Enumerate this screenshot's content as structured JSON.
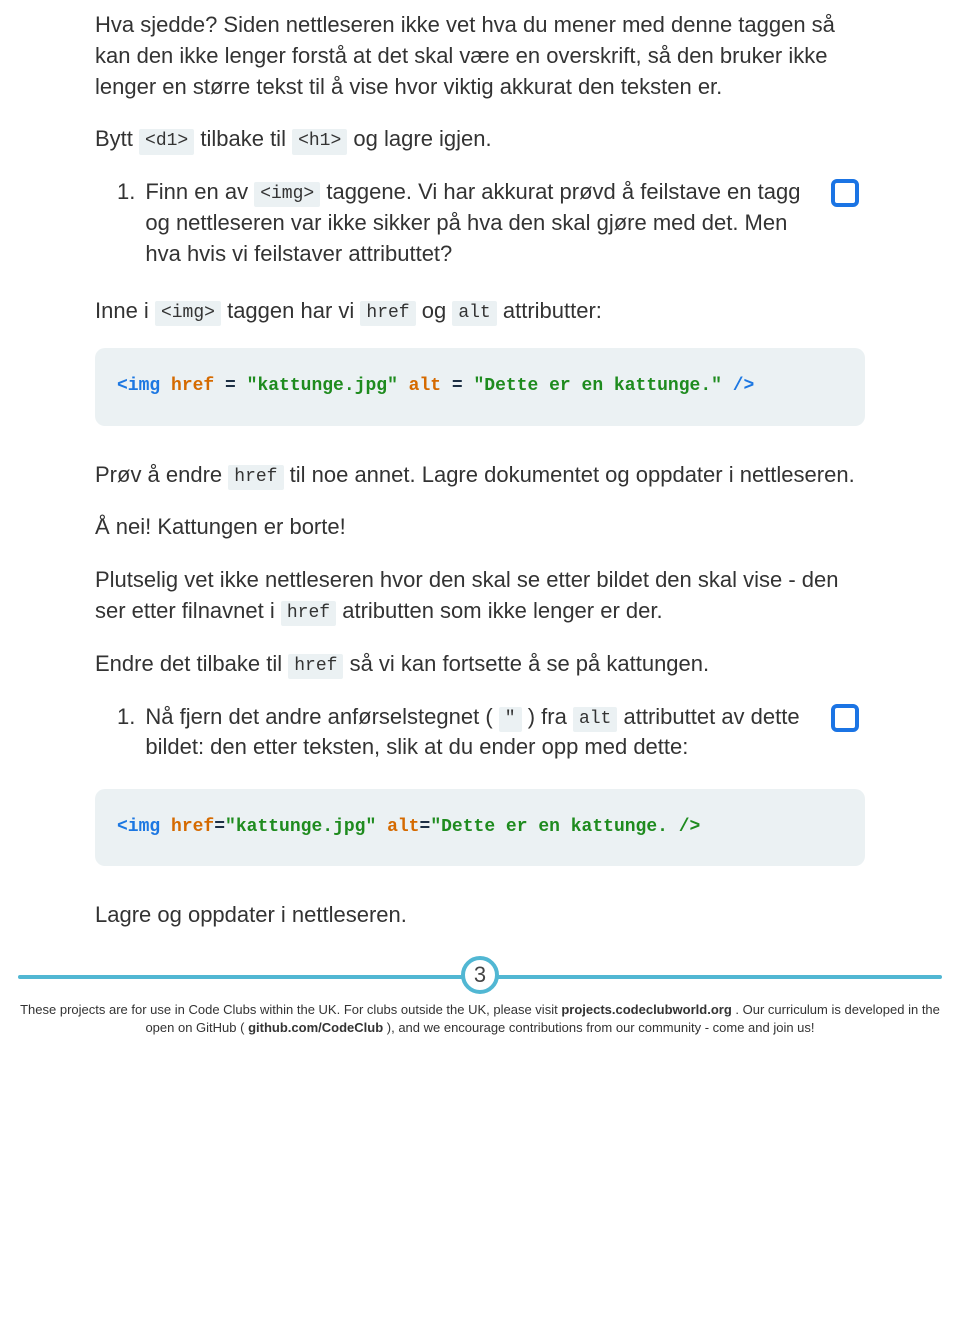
{
  "p1": "Hva sjedde? Siden nettleseren ikke vet hva du mener med denne taggen så kan den ikke lenger forstå at det skal være en overskrift, så den bruker ikke lenger en større tekst til å vise hvor viktig akkurat den teksten er.",
  "p2a": "Bytt ",
  "p2b": " tilbake til ",
  "p2c": " og lagre igjen.",
  "chip_d1": "<d1>",
  "chip_h1": "<h1>",
  "step1_num": "1.",
  "step1_a": "Finn en av ",
  "step1_chip_img": "<img>",
  "step1_b": " taggene. Vi har akkurat prøvd å feilstave en tagg og nettleseren var ikke sikker på hva den skal gjøre med det. Men hva hvis vi feilstaver attributtet?",
  "p3a": "Inne i ",
  "chip_img2": "<img>",
  "p3b": " taggen har vi ",
  "chip_href": "href",
  "p3c": " og ",
  "chip_alt": "alt",
  "p3d": " attributter:",
  "code1_tag_open": "<img",
  "code1_attr1": " href",
  "code1_eq": " = ",
  "code1_str1": "\"kattunge.jpg\"",
  "code1_attr2": " alt",
  "code1_str2": "\"Dette er en kattunge.\"",
  "code1_close": " />",
  "p4a": "Prøv å endre ",
  "chip_href2": "href",
  "p4b": " til noe annet. Lagre dokumentet og oppdater i nettleseren.",
  "p5": "Å nei! Kattungen er borte!",
  "p6a": "Plutselig vet ikke nettleseren hvor den skal se etter bildet den skal vise - den ser etter filnavnet i ",
  "chip_href3": "href",
  "p6b": " atributten som ikke lenger er der.",
  "p7a": "Endre det tilbake til ",
  "chip_href4": "href",
  "p7b": " så vi kan fortsette å se på kattungen.",
  "step2_num": "1.",
  "step2_a": "Nå fjern det andre anførselstegnet ( ",
  "chip_quote": "\"",
  "step2_b": " ) fra ",
  "chip_alt2": "alt",
  "step2_c": " attributtet av dette bildet: den etter teksten, slik at du ender opp med dette:",
  "code2_tag_open": "<img",
  "code2_attr1": " href",
  "code2_eq": "=",
  "code2_str1": "\"kattunge.jpg\"",
  "code2_attr2": " alt",
  "code2_str2": "\"Dette er en kattunge. />",
  "p8": "Lagre og oppdater i nettleseren.",
  "page_num": "3",
  "footer_a": "These projects are for use in Code Clubs within the UK. For clubs outside the UK, please visit ",
  "footer_link1": "projects.codeclubworld.org",
  "footer_b": ". Our curriculum is developed in the open on GitHub (",
  "footer_link2": "github.com/CodeClub",
  "footer_c": "), and we encourage contributions from our community - come and join us!"
}
